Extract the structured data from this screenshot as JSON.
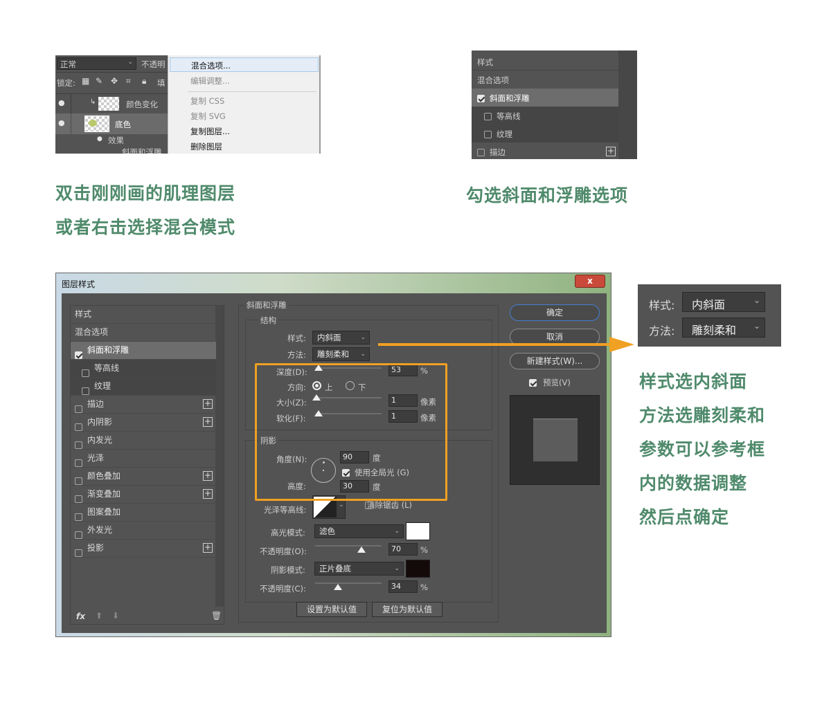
{
  "panel1": {
    "blend_mode": "正常",
    "opacity_label": "不透明",
    "lock_label": "锁定:",
    "fill_label": "填",
    "layer_color_change": "颜色变化",
    "layer_base": "底色",
    "effects_label": "效果",
    "bevel_partial": "斜面和浮雕",
    "menu": [
      "混合选项...",
      "编辑调整...",
      "复制 CSS",
      "复制 SVG",
      "复制图层...",
      "删除图层"
    ]
  },
  "panel2": {
    "items": [
      "样式",
      "混合选项",
      "斜面和浮雕",
      "等高线",
      "纹理",
      "描边"
    ]
  },
  "captions": {
    "left_line1": "双击刚刚画的肌理图层",
    "left_line2": "或者右击选择混合模式",
    "right": "勾选斜面和浮雕选项"
  },
  "dialog": {
    "title": "图层样式",
    "close": "x",
    "left_list": {
      "header": "样式",
      "blend": "混合选项",
      "bevel": "斜面和浮雕",
      "contour": "等高线",
      "texture": "纹理",
      "effects": [
        "描边",
        "内阴影",
        "内发光",
        "光泽",
        "颜色叠加",
        "渐变叠加",
        "图案叠加",
        "外发光",
        "投影"
      ],
      "fx": "fx"
    },
    "section_title": "斜面和浮雕",
    "structure": "结构",
    "style_label": "样式:",
    "style_value": "内斜面",
    "method_label": "方法:",
    "method_value": "雕刻柔和",
    "depth_label": "深度(D):",
    "depth_value": "53",
    "depth_unit": "%",
    "direction_label": "方向:",
    "dir_up": "上",
    "dir_down": "下",
    "size_label": "大小(Z):",
    "size_value": "1",
    "size_unit": "像素",
    "soften_label": "软化(F):",
    "soften_value": "1",
    "soften_unit": "像素",
    "shading": "阴影",
    "angle_label": "角度(N):",
    "angle_value": "90",
    "angle_unit": "度",
    "global_light": "使用全局光 (G)",
    "altitude_label": "高度:",
    "altitude_value": "30",
    "altitude_unit": "度",
    "gloss_label": "光泽等高线:",
    "antialias": "消除锯齿 (L)",
    "highlight_label": "高光模式:",
    "highlight_value": "滤色",
    "opacity1_label": "不透明度(O):",
    "opacity1_value": "70",
    "shadow_label": "阴影模式:",
    "shadow_value": "正片叠底",
    "opacity2_label": "不透明度(C):",
    "opacity2_value": "34",
    "pct": "%",
    "set_default": "设置为默认值",
    "reset_default": "复位为默认值",
    "ok": "确定",
    "cancel": "取消",
    "new_style": "新建样式(W)...",
    "preview": "预览(V)"
  },
  "sliders": {
    "depth": 0.05,
    "size": 0.02,
    "soften": 0.05,
    "opacity1": 0.7,
    "opacity2": 0.34
  },
  "zoom": {
    "style_label": "样式:",
    "style_value": "内斜面",
    "method_label": "方法:",
    "method_value": "雕刻柔和"
  },
  "instructions": [
    "样式选内斜面",
    "方法选雕刻柔和",
    "参数可以参考框",
    "内的数据调整",
    "然后点确定"
  ],
  "colors": {
    "accent": "#f0a023",
    "caption": "#4f8a6b",
    "panel": "#535353"
  }
}
